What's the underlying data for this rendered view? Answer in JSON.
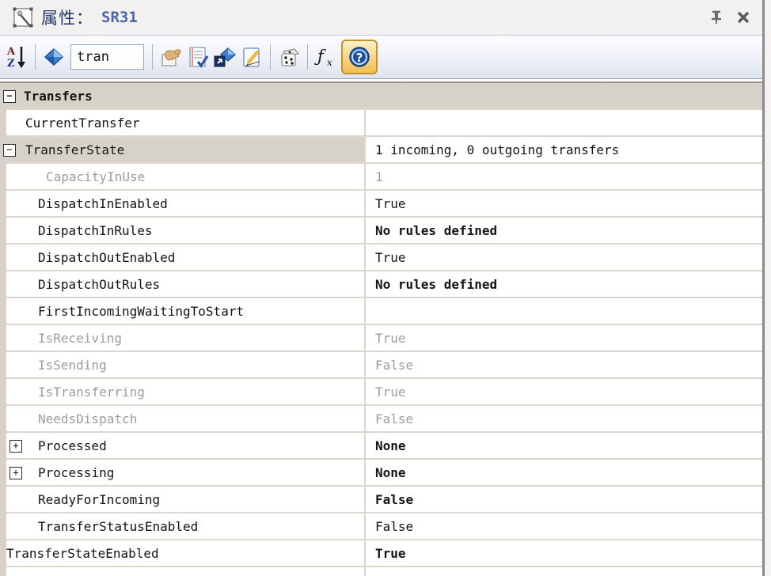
{
  "panel": {
    "title_label": "属性：",
    "title_value": "SR31",
    "window_icons": [
      "properties-icon",
      "pin-icon",
      "close-icon"
    ]
  },
  "toolbar": {
    "search_value": "tran",
    "icons": [
      "sort-az-icon",
      "filter-diamond-icon",
      "search-input",
      "hand-pick-icon",
      "checklist-icon",
      "jump-to-object-icon",
      "edit-note-icon",
      "dice-icon",
      "function-icon",
      "help-icon"
    ],
    "help_active": true,
    "accent_colors": {
      "help_border": "#c68f2d",
      "help_fill": "#f6d27a",
      "toolbar_bg": "#dde3ee"
    }
  },
  "grid": {
    "colors": {
      "category_bg": "#d6d2c9",
      "row_border": "#dbd7cd",
      "readonly_text": "#9c9c9c"
    },
    "rows": [
      {
        "name": "Transfers",
        "value": "",
        "level": 0,
        "category": true,
        "expander": "-"
      },
      {
        "name": "CurrentTransfer",
        "value": "",
        "level": 1
      },
      {
        "name": "TransferState",
        "value": "1 incoming, 0 outgoing transfers",
        "level": 1,
        "expander": "-",
        "gray_name": true
      },
      {
        "name": "CapacityInUse",
        "value": "1",
        "level": 2,
        "readonly": true,
        "deep": true
      },
      {
        "name": "DispatchInEnabled",
        "value": "True",
        "level": 2
      },
      {
        "name": "DispatchInRules",
        "value": "No rules defined",
        "level": 2,
        "bold_value": true
      },
      {
        "name": "DispatchOutEnabled",
        "value": "True",
        "level": 2
      },
      {
        "name": "DispatchOutRules",
        "value": "No rules defined",
        "level": 2,
        "bold_value": true
      },
      {
        "name": "FirstIncomingWaitingToStart",
        "value": "",
        "level": 2
      },
      {
        "name": "IsReceiving",
        "value": "True",
        "level": 2,
        "readonly": true
      },
      {
        "name": "IsSending",
        "value": "False",
        "level": 2,
        "readonly": true
      },
      {
        "name": "IsTransferring",
        "value": "True",
        "level": 2,
        "readonly": true
      },
      {
        "name": "NeedsDispatch",
        "value": "False",
        "level": 2,
        "readonly": true
      },
      {
        "name": "Processed",
        "value": "None",
        "level": 2,
        "expander": "+",
        "bold_value": true
      },
      {
        "name": "Processing",
        "value": "None",
        "level": 2,
        "expander": "+",
        "bold_value": true
      },
      {
        "name": "ReadyForIncoming",
        "value": "False",
        "level": 2,
        "bold_value": true
      },
      {
        "name": "TransferStatusEnabled",
        "value": "False",
        "level": 2
      },
      {
        "name": "TransferStateEnabled",
        "value": "True",
        "level": 0,
        "plain": true,
        "bold_value": true
      }
    ]
  }
}
